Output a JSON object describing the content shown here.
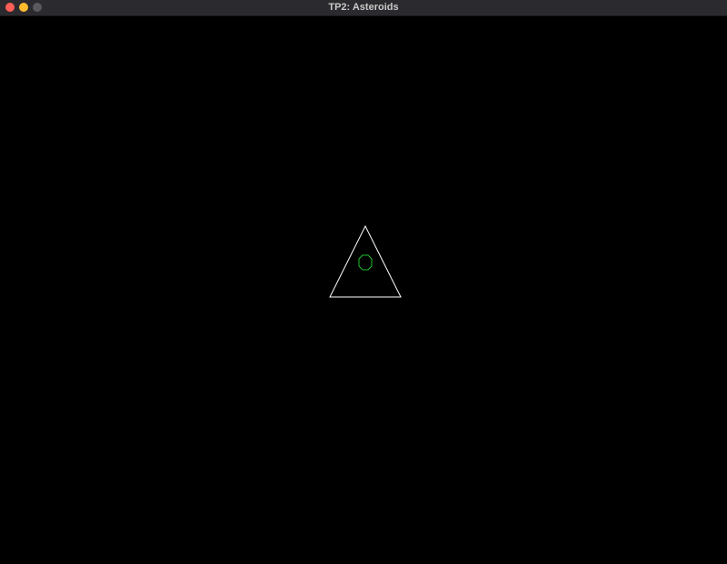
{
  "window": {
    "title": "TP2: Asteroids",
    "controls": {
      "close_color": "#ff5f57",
      "minimize_color": "#febc2e",
      "zoom_color": "#5a5a5e"
    }
  },
  "game": {
    "background_color": "#000000",
    "ship": {
      "shape": "triangle-outline",
      "stroke_color": "#ffffff"
    },
    "ship_core": {
      "shape": "octagon-outline",
      "stroke_color": "#1fbf2f"
    }
  }
}
